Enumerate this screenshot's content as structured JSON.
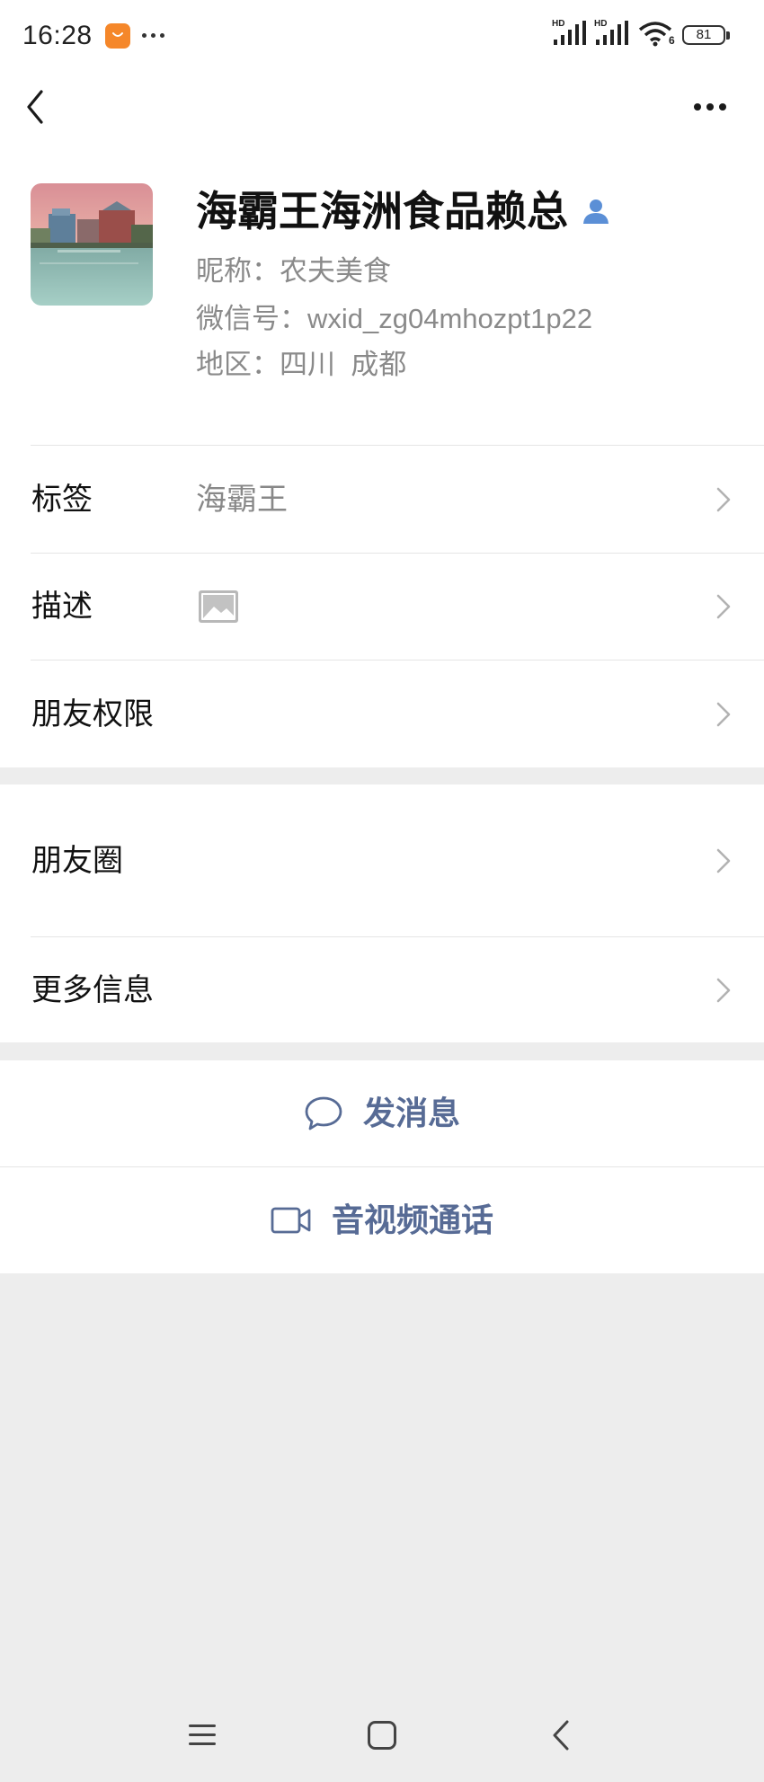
{
  "status_bar": {
    "time": "16:28",
    "signal_1_label": "HD",
    "signal_2_label": "HD",
    "wifi_badge": "6",
    "battery_level": "81"
  },
  "profile": {
    "name": "海霸王海洲食品赖总",
    "nickname_label": "昵称：",
    "nickname": "农夫美食",
    "wechat_id_label": "微信号：",
    "wechat_id": "wxid_zg04mhozpt1p22",
    "region_label": "地区：",
    "region": "四川  成都"
  },
  "rows": [
    {
      "label": "标签",
      "value": "海霸王"
    },
    {
      "label": "描述",
      "value_icon": "image-icon"
    },
    {
      "label": "朋友权限"
    },
    {
      "label": "朋友圈"
    },
    {
      "label": "更多信息"
    }
  ],
  "actions": {
    "send_message": "发消息",
    "av_call": "音视频通话"
  },
  "icons": {
    "status": [
      "app-notification-icon",
      "more-dots-icon",
      "signal-icon",
      "wifi-icon",
      "battery-icon"
    ],
    "nav": [
      "back-icon",
      "more-icon"
    ],
    "profile": [
      "avatar",
      "contact-person-icon"
    ],
    "actions": [
      "message-bubble-icon",
      "video-camera-icon"
    ],
    "system_nav": [
      "menu-icon",
      "home-icon",
      "back-icon"
    ]
  },
  "colors": {
    "link": "#576b95",
    "secondary_text": "#888888",
    "page_bg": "#ededed",
    "card_bg": "#ffffff",
    "badge_orange": "#f5872a",
    "person_badge_blue": "#5b8fd6"
  }
}
